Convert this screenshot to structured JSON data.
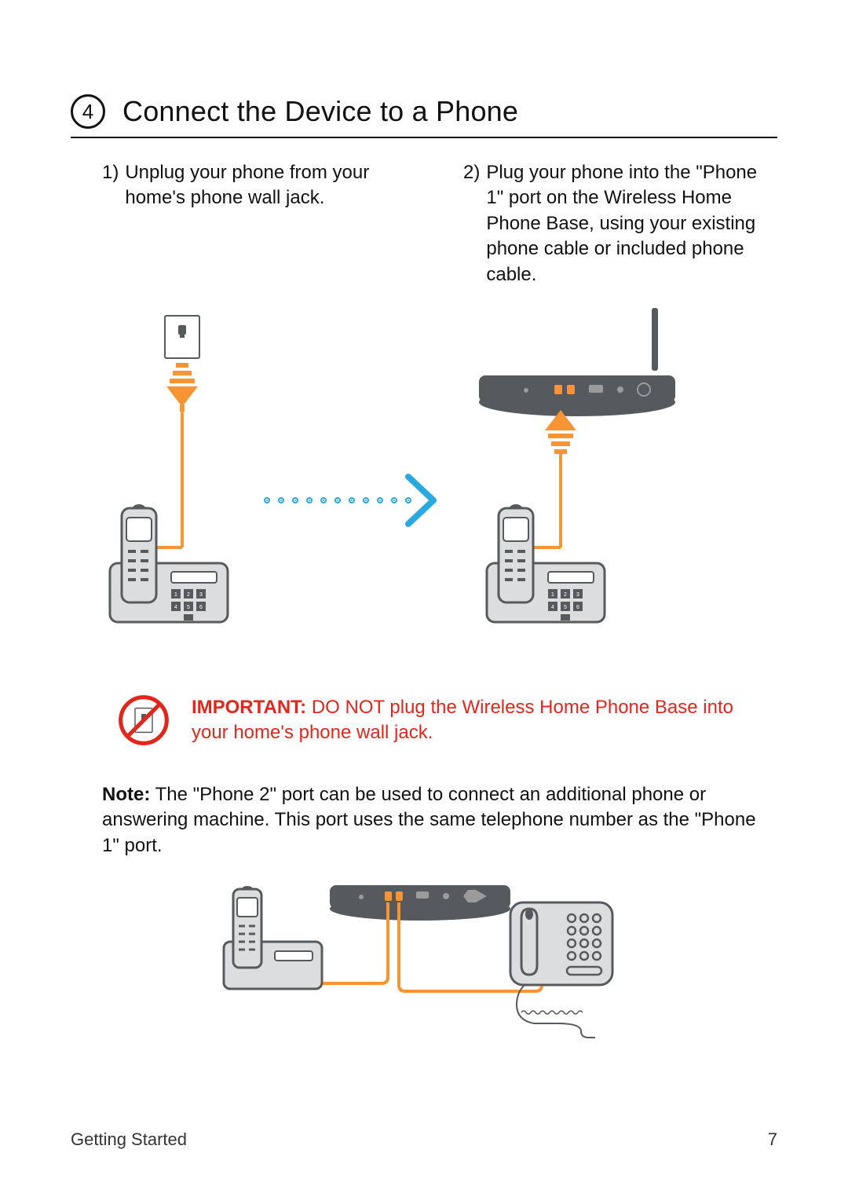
{
  "step_number": "4",
  "heading": "Connect the Device to a Phone",
  "step1": {
    "num": "1)",
    "text": "Unplug your phone from your home's phone wall jack."
  },
  "step2": {
    "num": "2)",
    "text": "Plug your phone into the \"Phone 1\" port on the Wireless Home Phone Base, using your existing phone cable or included phone cable."
  },
  "important": {
    "label": "IMPORTANT:",
    "text": " DO NOT plug the Wireless Home Phone Base into your home's phone wall jack."
  },
  "note": {
    "label": "Note:",
    "text": " The \"Phone 2\" port can be used to connect an additional phone or answering machine. This port uses the same telephone number as the \"Phone 1\" port."
  },
  "footer": {
    "section": "Getting Started",
    "page": "7"
  },
  "colors": {
    "orange": "#f79433",
    "blue": "#2aa8e0",
    "red": "#e1261c",
    "gray_fill": "#dcddde",
    "gray_dark": "#575a5c"
  }
}
